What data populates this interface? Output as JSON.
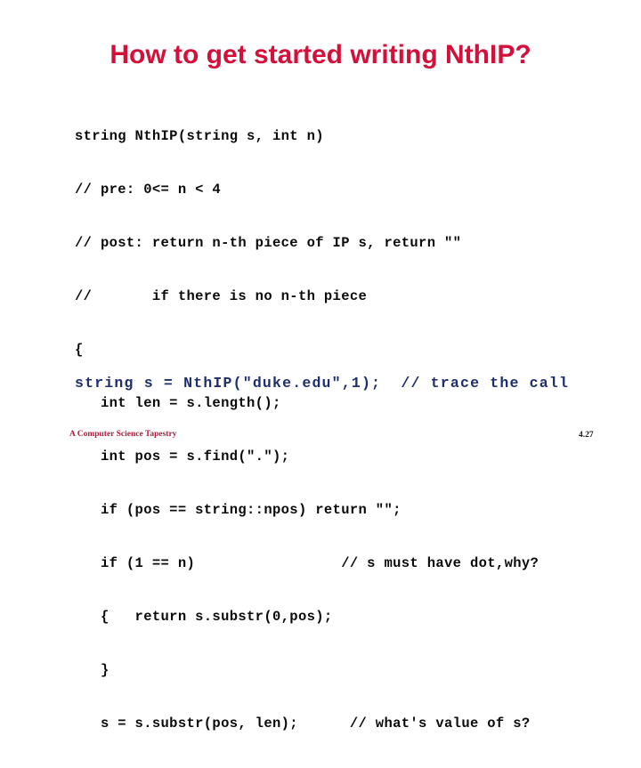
{
  "slide": {
    "title": "How to get started writing NthIP?",
    "background_color": "#ffffff",
    "title_color": "#D2103A",
    "code_color": "#0A0A0A",
    "call_color": "#1F2F6E",
    "brand_color": "#B01C3C"
  },
  "code": {
    "lines": [
      "string NthIP(string s, int n)",
      "// pre: 0<= n < 4",
      "// post: return n-th piece of IP s, return \"\"",
      "//       if there is no n-th piece",
      "{",
      "   int len = s.length();",
      "   int pos = s.find(\".\");",
      "   if (pos == string::npos) return \"\";",
      "   if (1 == n)                 // s must have dot,why?",
      "   {   return s.substr(0,pos);",
      "   }",
      "   s = s.substr(pos, len);      // what's value of s?"
    ]
  },
  "call": {
    "text": "string s = NthIP(\"duke.edu\",1);  // trace the call"
  },
  "footer": {
    "brand": "A Computer Science Tapestry",
    "page": "4.27"
  }
}
